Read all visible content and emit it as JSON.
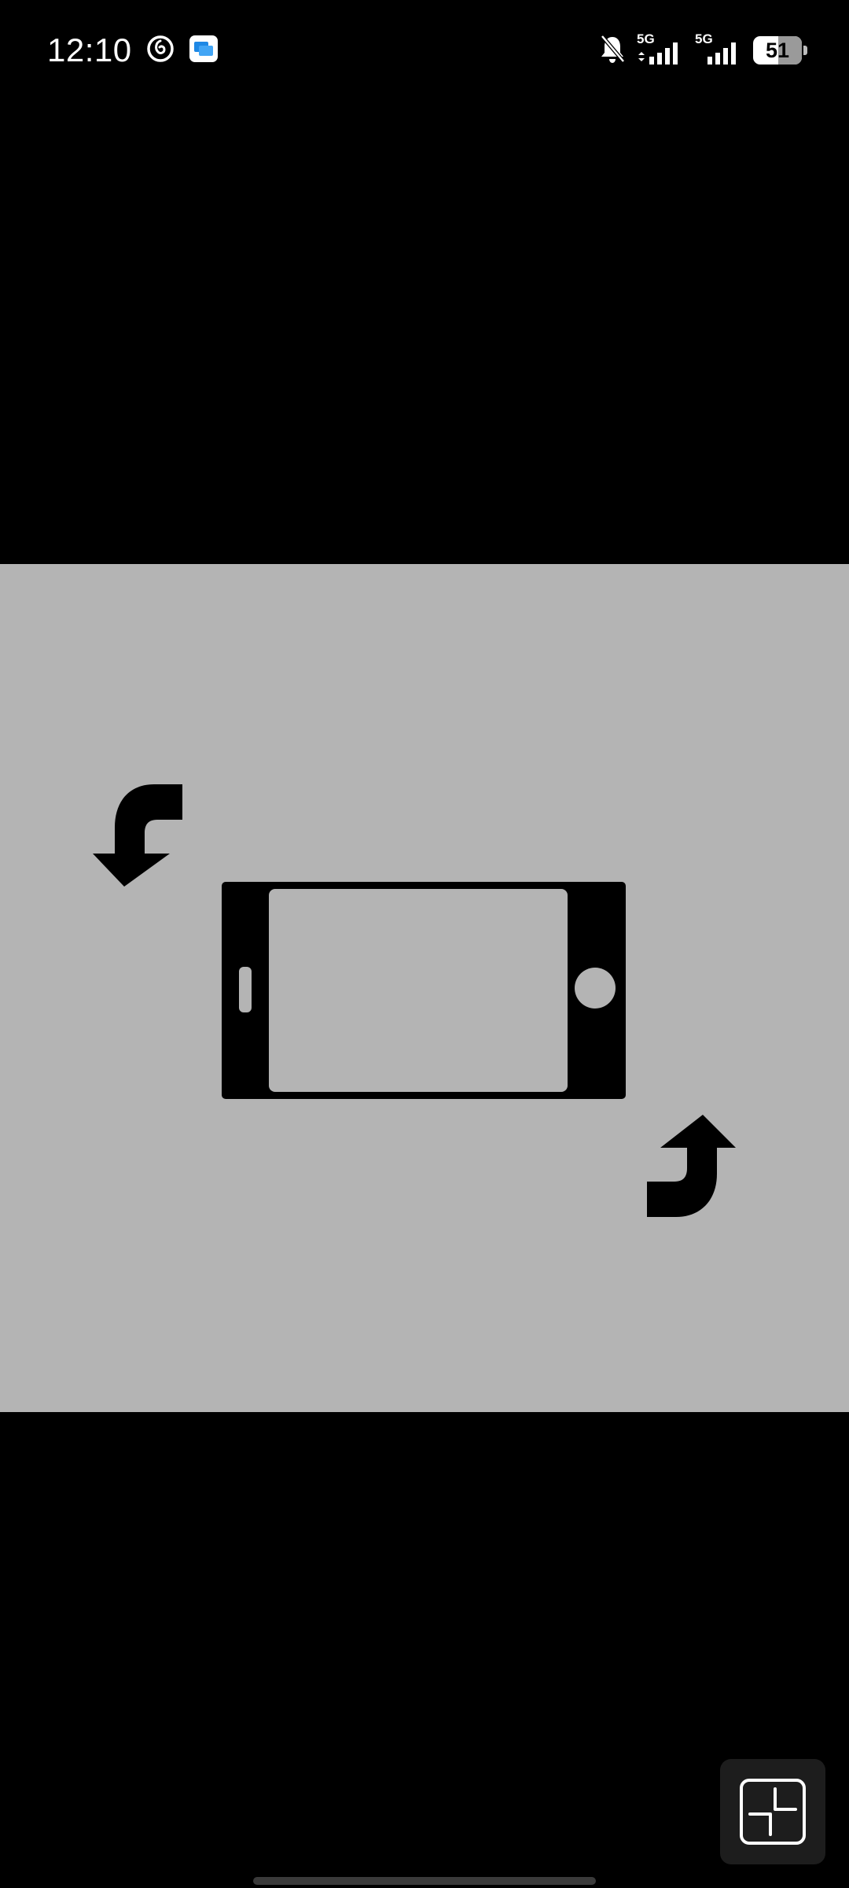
{
  "status_bar": {
    "time": "12:10",
    "left_icons": [
      "netease-music-icon",
      "app-notification-icon"
    ],
    "right_icons": [
      "silent-bell-icon",
      "signal-5g-icon",
      "signal-5g-icon"
    ],
    "sim1_network": "5G",
    "sim2_network": "5G",
    "battery_level": "51",
    "battery_percent": 51
  },
  "rotate_hint": {
    "background_color": "#b4b4b4",
    "icon_color": "#000000",
    "icons": [
      "rotate-arrow-icon",
      "landscape-phone-icon",
      "rotate-arrow-icon"
    ]
  },
  "controls": {
    "exit_fullscreen_icon": "exit-fullscreen-icon"
  },
  "colors": {
    "background": "#000000",
    "panel": "#b4b4b4",
    "button_bg": "#1d1d1d"
  }
}
